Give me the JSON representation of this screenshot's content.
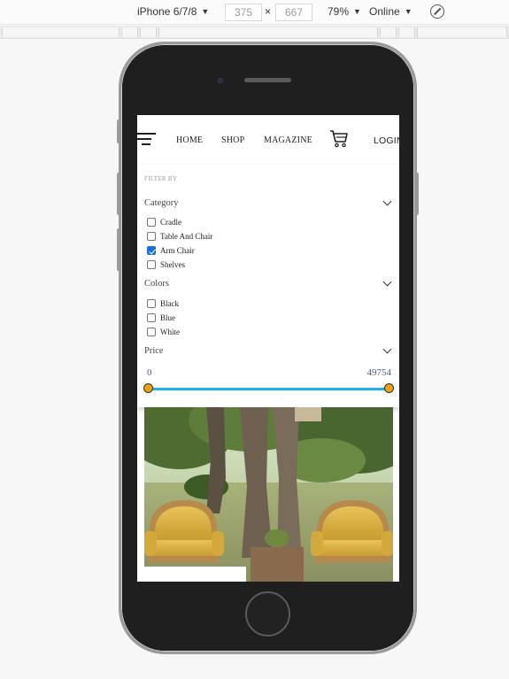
{
  "devtools": {
    "device": "iPhone 6/7/8",
    "width": "375",
    "times": "×",
    "height": "667",
    "zoom": "79%",
    "network": "Online",
    "rotate_icon": "rotate-icon"
  },
  "nav": {
    "menu_icon": "hamburger-menu-icon",
    "links": [
      "HOME",
      "SHOP",
      "MAGAZINE"
    ],
    "cart_icon": "cart-icon",
    "login": "LOGIN"
  },
  "filter": {
    "label": "FILTER BY",
    "category": {
      "title": "Category",
      "options": [
        {
          "label": "Cradle",
          "checked": false
        },
        {
          "label": "Table And Chair",
          "checked": false
        },
        {
          "label": "Arm Chair",
          "checked": true
        },
        {
          "label": "Shelves",
          "checked": false
        }
      ]
    },
    "colors": {
      "title": "Colors",
      "options": [
        {
          "label": "Black",
          "checked": false
        },
        {
          "label": "Blue",
          "checked": false
        },
        {
          "label": "White",
          "checked": false
        }
      ]
    },
    "price": {
      "title": "Price",
      "min": "0",
      "max": "49754"
    }
  },
  "colors": {
    "slider_track": "#1eb3e6",
    "slider_handle": "#f0a215",
    "checkbox_checked": "#1a6fd6"
  }
}
